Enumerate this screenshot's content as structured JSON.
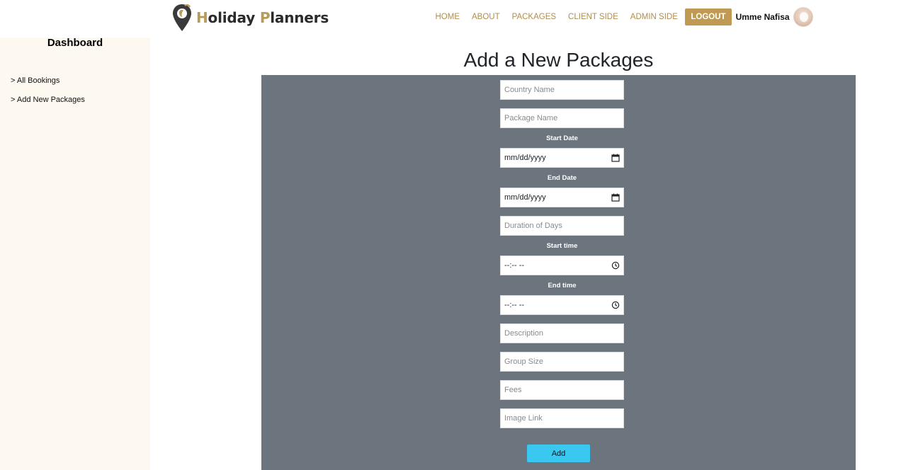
{
  "brand": {
    "first_letter": "H",
    "first_rest": "oliday",
    "second_letter": "P",
    "second_rest": "lanners"
  },
  "nav": {
    "home": "HOME",
    "about": "ABOUT",
    "packages": "PACKAGES",
    "client_side": "CLIENT SIDE",
    "admin_side": "ADMIN SIDE",
    "logout": "LOGOUT"
  },
  "user": {
    "name": "Umme Nafisa"
  },
  "sidebar": {
    "title": "Dashboard",
    "items": [
      {
        "label": "> All Bookings"
      },
      {
        "label": "> Add New Packages"
      }
    ]
  },
  "main": {
    "title": "Add a New Packages"
  },
  "form": {
    "country_placeholder": "Country Name",
    "package_placeholder": "Package Name",
    "start_date_label": "Start Date",
    "start_date_value": "mm/dd/yyyy",
    "end_date_label": "End Date",
    "end_date_value": "mm/dd/yyyy",
    "duration_placeholder": "Duration of Days",
    "start_time_label": "Start time",
    "start_time_value": "--:-- --",
    "end_time_label": "End time",
    "end_time_value": "--:-- --",
    "description_placeholder": "Description",
    "group_size_placeholder": "Group Size",
    "fees_placeholder": "Fees",
    "image_link_placeholder": "Image Link",
    "submit_label": "Add"
  },
  "colors": {
    "accent_gold": "#c09a52",
    "nav_text": "#b08d4f",
    "panel_bg": "#6c757d",
    "sidebar_bg": "#fdf8f0",
    "add_button": "#3bc8f0"
  },
  "icons": {
    "logo": "location-pin-logo-icon",
    "date": "calendar-icon",
    "time": "clock-icon"
  }
}
